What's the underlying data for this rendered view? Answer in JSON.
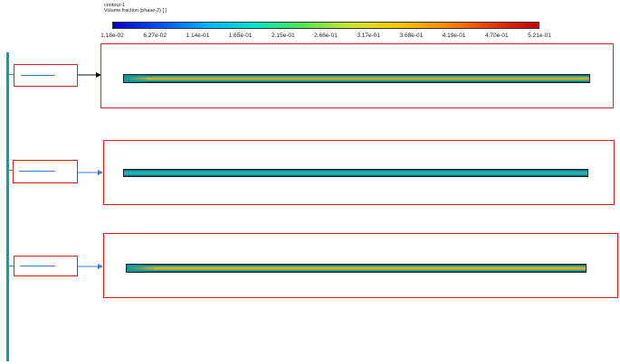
{
  "header": {
    "title": "contour-1",
    "subtitle": "Volume fraction (phase-2)  [ ]"
  },
  "colorbar": {
    "tick_labels": [
      "1.18e-02",
      "6.27e-02",
      "1.14e-01",
      "1.65e-01",
      "2.15e-01",
      "2.66e-01",
      "3.17e-01",
      "3.68e-01",
      "4.19e-01",
      "4.70e-01",
      "5.21e-01"
    ],
    "colors": [
      "#0000c8",
      "#0050ff",
      "#00b4ff",
      "#00e6c8",
      "#50e650",
      "#c8e632",
      "#ffc800",
      "#ff8c00",
      "#e63c00",
      "#c80000"
    ]
  },
  "colors": {
    "accent_trunk": "#179aa4",
    "connector": "#3b7ec9",
    "frame": "#e02020",
    "pipe_base": "#20a3a8"
  }
}
